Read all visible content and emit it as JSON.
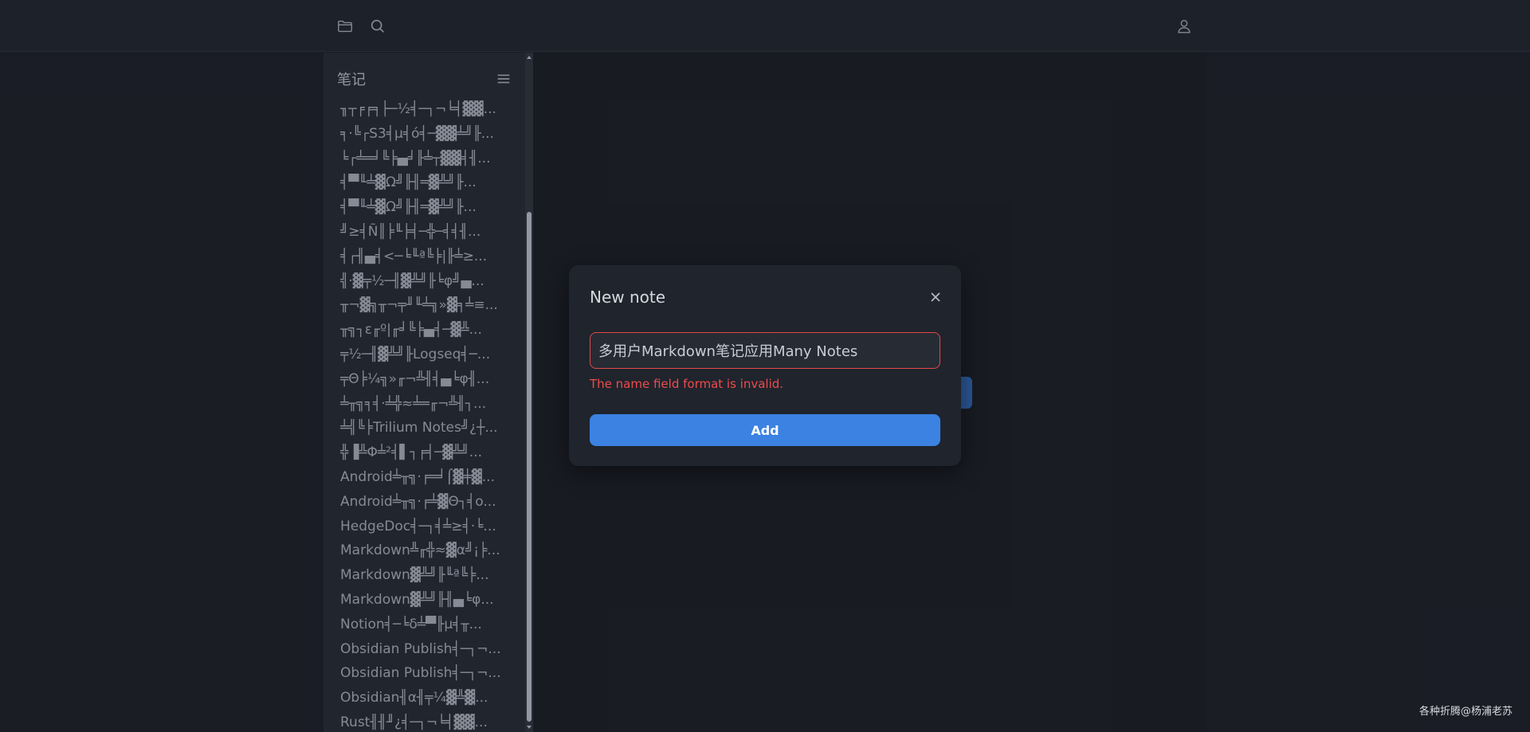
{
  "topbar": {
    "icons": [
      "folder-icon",
      "search-icon",
      "user-icon"
    ]
  },
  "sidebar": {
    "title": "笔记",
    "notes": [
      "╖┬╒╒╕├─½╡─┐¬╘╡▓▓...",
      "╕·╚┌S3╡µ╡ó╡─▓▓╧╝╟...",
      "╘┌╧═╛╚╞▄╛╟╧┬▓▓╡╢...",
      "╡▀╙╧▓Ω╝╟╢═▓╩╝╟...",
      "╡▀╙╧▓Ω╝╟╢═▓╩╝╟...",
      "╝≥╡Ñ║╞╙╞╡─╬─╡╡╢...",
      "╡┌╢▄╡<─╘╙ª╚╞|╟╧≥...",
      "╣·▓╤½─╢▓╩╝╟╘φ╝▄...",
      "╥¬▓╗╥¬╤╜╙╧╗»▓╕╧≡...",
      "╥╗┐ε╓º|╓╛╚╞▄╡─▓╩...",
      "╤½─╢▓╩╝╟Logseq╡─...",
      "╤Θ╞¼╗»╓¬╩╢╡▄╘φ╢...",
      "╧╥╗╕╡·╧╬≈╧═╓¬╩╢┐...",
      "╧╣╚╞Trilium Notes╝¿┼...",
      "╬▐╩Φ╧²╡▌┐╒╡─▓╩╝...",
      "Android╧╥╗·╒═╛⌠▓╪▓...",
      "Android╧╥╗·╒╧▓Θ┐╡o...",
      "HedgeDoc╡─┐╡╧≥╡·╘...",
      "Markdown╩╓╬≈▓α╝¡╞...",
      "Markdown▓╩╝╟╙ª╚╞...",
      "Markdown▓╩╝╟╢▄╘φ...",
      "Notion╡─╘δ╧▀╟µ╡╥...",
      "Obsidian Publish╡─┐¬...",
      "Obsidian Publish╡─┐¬...",
      "Obsidian╢α╢╤¼▓╩▓...",
      "Rust╢╢╜¿╡─┐¬╘╡▓▓..."
    ]
  },
  "modal": {
    "title": "New note",
    "input_value": "多用户Markdown笔记应用Many Notes",
    "error": "The name field format is invalid.",
    "add_label": "Add"
  },
  "watermark": "各种折腾@杨浦老苏",
  "colors": {
    "accent": "#3b82e3",
    "error": "#ef4b4b",
    "background": "#1c1f27"
  }
}
